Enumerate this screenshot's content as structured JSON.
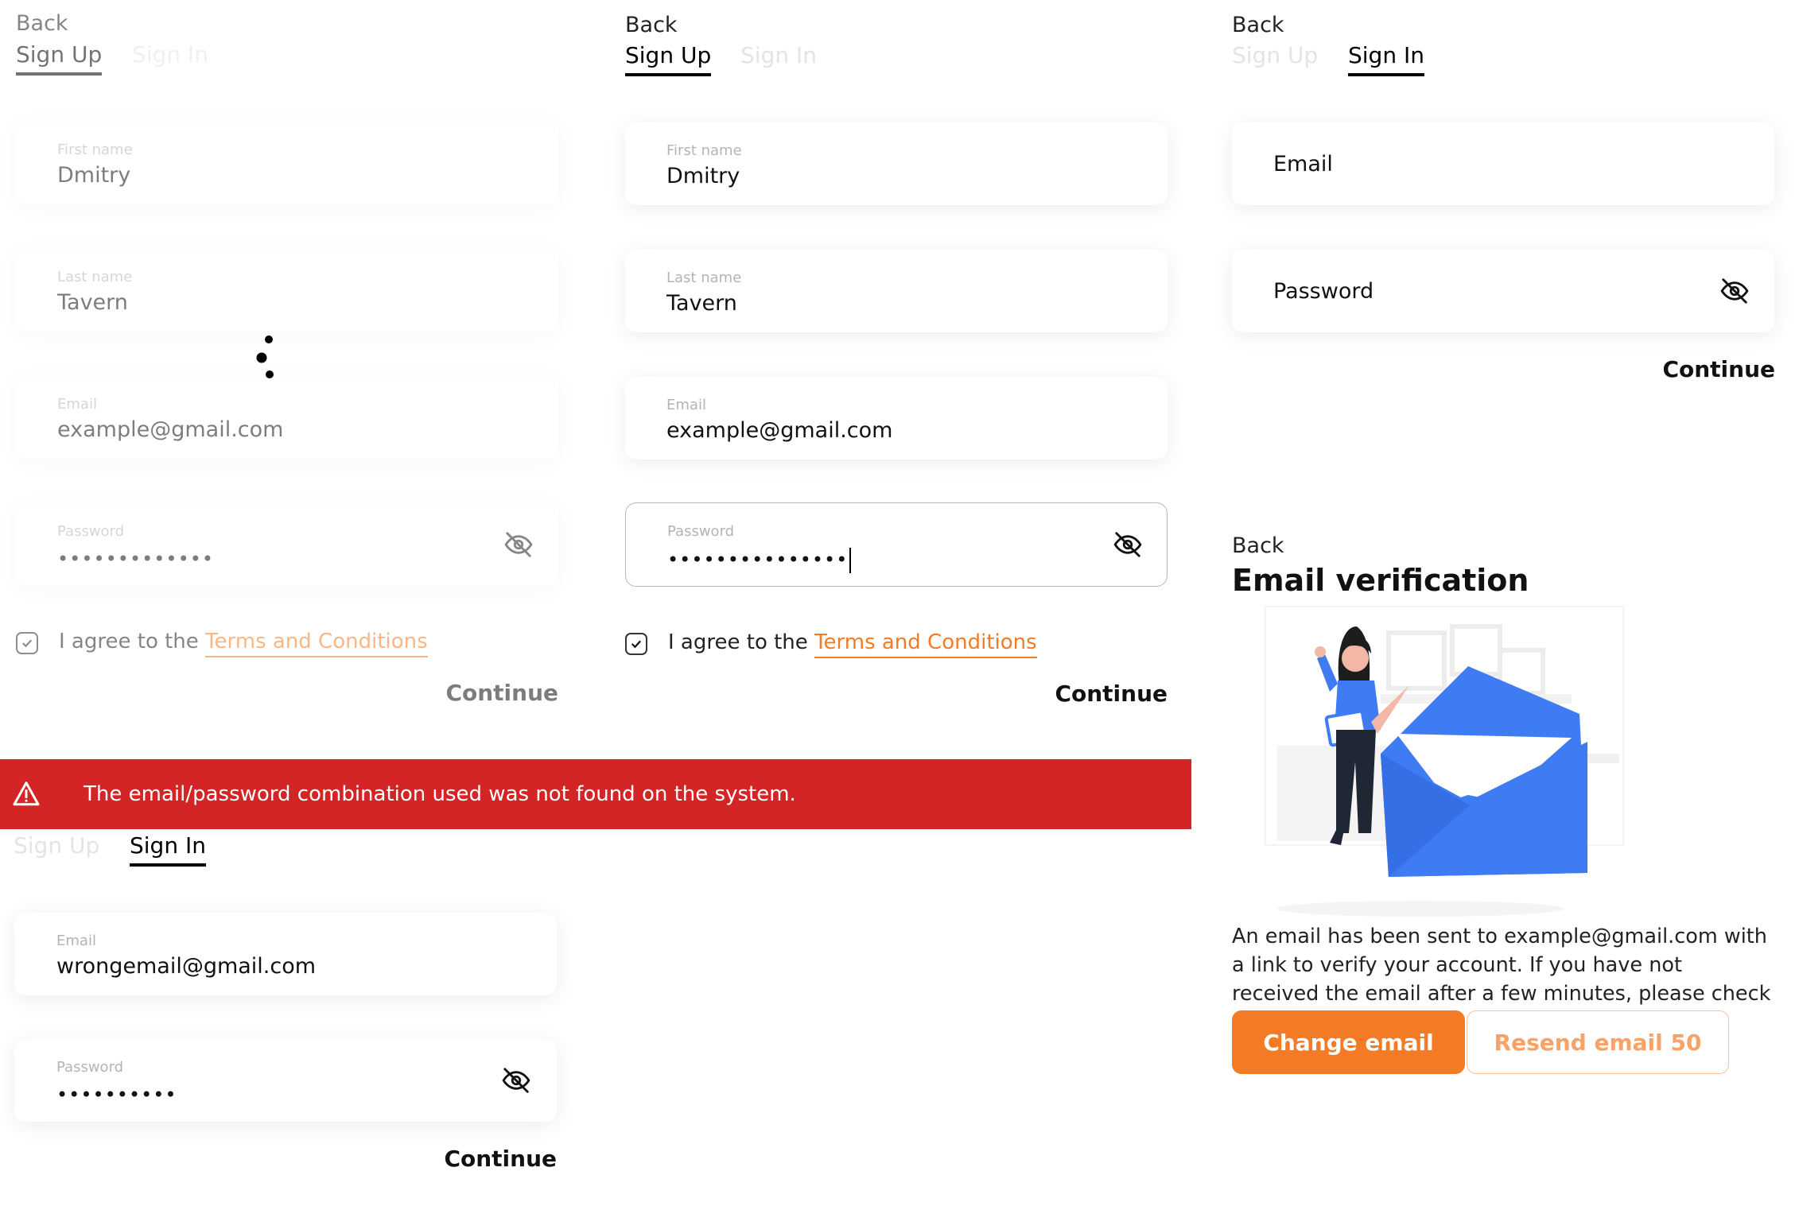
{
  "screen1": {
    "back": "Back",
    "tabs": {
      "signup": "Sign Up",
      "signin": "Sign In"
    },
    "first_name": {
      "label": "First name",
      "value": "Dmitry"
    },
    "last_name": {
      "label": "Last name",
      "value": "Tavern"
    },
    "email": {
      "label": "Email",
      "value": "example@gmail.com"
    },
    "password": {
      "label": "Password",
      "value": "•••••••••••••"
    },
    "agree_text": "I agree to the",
    "terms_link": "Terms and Conditions",
    "continue": "Continue",
    "loading": "loading-spinner"
  },
  "screen2": {
    "back": "Back",
    "tabs": {
      "signup": "Sign Up",
      "signin": "Sign In"
    },
    "first_name": {
      "label": "First name",
      "value": "Dmitry"
    },
    "last_name": {
      "label": "Last name",
      "value": "Tavern"
    },
    "email": {
      "label": "Email",
      "value": "example@gmail.com"
    },
    "password": {
      "label": "Password",
      "value": "•••••••••••••••"
    },
    "agree_text": "I agree to the",
    "terms_link": "Terms and Conditions",
    "continue": "Continue"
  },
  "screen3": {
    "back": "Back",
    "tabs": {
      "signup": "Sign Up",
      "signin": "Sign In"
    },
    "email_placeholder": "Email",
    "password_placeholder": "Password",
    "continue": "Continue"
  },
  "screen4": {
    "error_message": "The email/password combination used was not found on the system.",
    "tabs": {
      "signup": "Sign Up",
      "signin": "Sign In"
    },
    "email": {
      "label": "Email",
      "value": "wrongemail@gmail.com"
    },
    "password": {
      "label": "Password",
      "value": "••••••••••"
    },
    "continue": "Continue"
  },
  "screen5": {
    "back": "Back",
    "title": "Email verification",
    "message": "An email has been sent to example@gmail.com with a link to verify your account. If you have not received the email after a few minutes, please check your spam folder",
    "change_email": "Change email",
    "resend_email": "Resend email 50"
  },
  "colors": {
    "accent": "#f47b25",
    "error": "#d32426",
    "envelope": "#3f7cf4"
  },
  "icons": {
    "password_toggle": "eye-off-icon",
    "checkbox": "check-icon",
    "warning": "warning-triangle-icon"
  }
}
